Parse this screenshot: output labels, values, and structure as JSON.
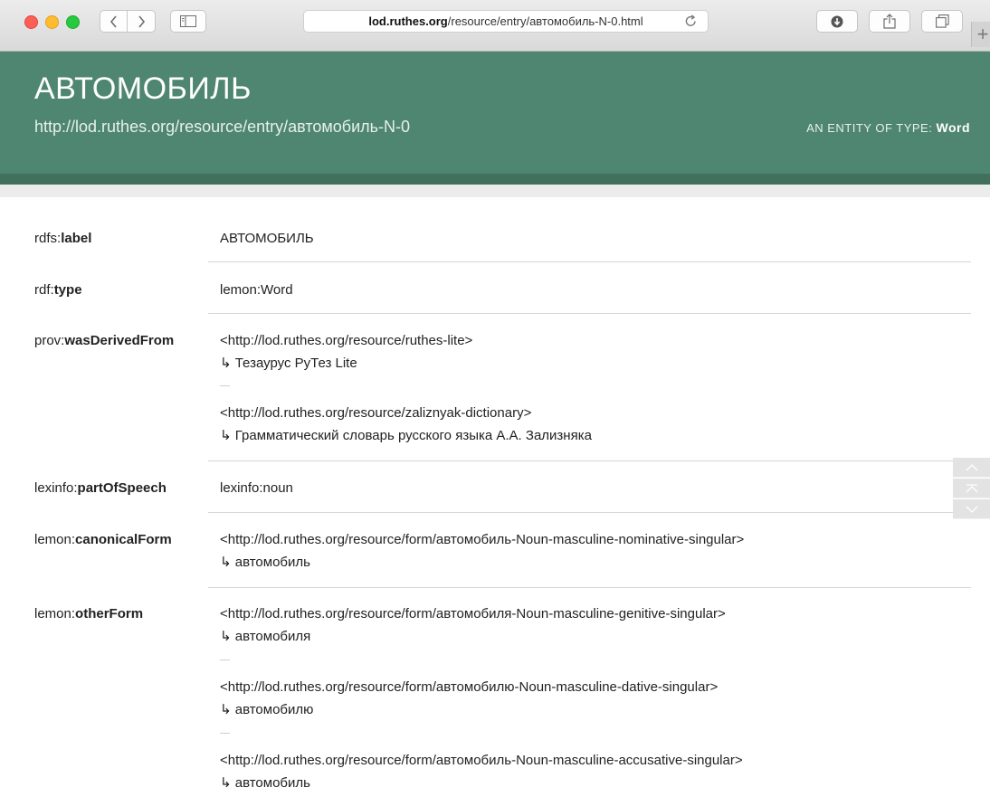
{
  "browser": {
    "url_host": "lod.ruthes.org",
    "url_path": "/resource/entry/автомобиль-N-0.html",
    "new_tab_label": "+"
  },
  "header": {
    "title": "АВТОМОБИЛЬ",
    "uri": "http://lod.ruthes.org/resource/entry/автомобиль-N-0",
    "type_prefix": "AN ENTITY OF TYPE:",
    "type_value": "Word"
  },
  "properties": [
    {
      "prefix": "rdfs:",
      "local": "label",
      "values": [
        {
          "text": "АВТОМОБИЛЬ"
        }
      ]
    },
    {
      "prefix": "rdf:",
      "local": "type",
      "values": [
        {
          "text": "lemon:Word"
        }
      ]
    },
    {
      "prefix": "prov:",
      "local": "wasDerivedFrom",
      "values": [
        {
          "text": "<http://lod.ruthes.org/resource/ruthes-lite>",
          "label": "↳ Тезаурус РуТез Lite"
        },
        {
          "text": "<http://lod.ruthes.org/resource/zaliznyak-dictionary>",
          "label": "↳ Грамматический словарь русского языка А.А. Зализняка"
        }
      ]
    },
    {
      "prefix": "lexinfo:",
      "local": "partOfSpeech",
      "values": [
        {
          "text": "lexinfo:noun"
        }
      ]
    },
    {
      "prefix": "lemon:",
      "local": "canonicalForm",
      "values": [
        {
          "text": "<http://lod.ruthes.org/resource/form/автомобиль-Noun-masculine-nominative-singular>",
          "label": "↳ автомобиль"
        }
      ]
    },
    {
      "prefix": "lemon:",
      "local": "otherForm",
      "values": [
        {
          "text": "<http://lod.ruthes.org/resource/form/автомобиля-Noun-masculine-genitive-singular>",
          "label": "↳ автомобиля"
        },
        {
          "text": "<http://lod.ruthes.org/resource/form/автомобилю-Noun-masculine-dative-singular>",
          "label": "↳ автомобилю"
        },
        {
          "text": "<http://lod.ruthes.org/resource/form/автомобиль-Noun-masculine-accusative-singular>",
          "label": "↳ автомобиль"
        }
      ]
    }
  ],
  "icons": {
    "back": "chevron-left-icon",
    "forward": "chevron-right-icon",
    "sidebar": "sidebar-icon",
    "reload": "reload-icon",
    "download": "download-icon",
    "share": "share-icon",
    "tabs": "tabs-overview-icon",
    "scroll_up": "chevron-up-icon",
    "scroll_top": "scroll-to-top-icon",
    "scroll_down": "chevron-down-icon"
  },
  "colors": {
    "header": "#4f8672",
    "header_bar": "#41705f",
    "accent_text": "#ffffff"
  }
}
